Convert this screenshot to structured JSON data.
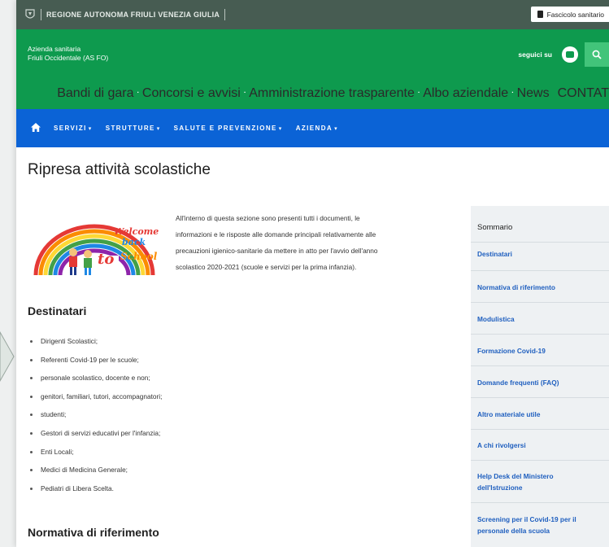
{
  "region_bar": {
    "text": "REGIONE AUTONOMA FRIULI VENEZIA GIULIA",
    "fascicolo_label": "Fascicolo sanitario"
  },
  "header": {
    "org_line1": "Azienda sanitaria",
    "org_line2": "Friuli Occidentale (AS FO)",
    "seguici": "seguici su",
    "service_links": [
      "Bandi di gara",
      "Concorsi e avvisi",
      "Amministrazione trasparente",
      "Albo aziendale",
      "News",
      "CONTAT"
    ]
  },
  "nav": {
    "items": [
      "SERVIZI",
      "STRUTTURE",
      "SALUTE E PREVENZIONE",
      "AZIENDA"
    ]
  },
  "main": {
    "title": "Ripresa attività scolastiche",
    "intro_lines": [
      "All'interno di questa sezione sono presenti tutti i documenti, le",
      "informazioni e le risposte alle domande principali relativamente alle",
      "precauzioni igienico-sanitarie da mettere in atto per l'avvio dell'anno",
      "scolastico 2020-2021 (scuole e servizi per la prima infanzia)."
    ],
    "logo_text": [
      "Welcome",
      "back",
      "to",
      "School"
    ],
    "destinatari_title": "Destinatari",
    "destinatari": [
      "Dirigenti Scolastici;",
      "Referenti Covid-19 per le scuole;",
      "personale scolastico, docente e non;",
      "genitori, familiari, tutori, accompagnatori;",
      "studenti;",
      "Gestori di servizi educativi per l'infanzia;",
      "Enti Locali;",
      "Medici di Medicina Generale;",
      "Pediatri di Libera Scelta."
    ],
    "normativa_title": "Normativa di riferimento"
  },
  "sommario": {
    "title": "Sommario",
    "links": [
      [
        "Destinatari"
      ],
      [
        "Normativa di riferimento"
      ],
      [
        "Modulistica"
      ],
      [
        "Formazione Covid-19"
      ],
      [
        "Domande frequenti (FAQ)"
      ],
      [
        "Altro materiale utile"
      ],
      [
        "A chi rivolgersi"
      ],
      [
        "Help Desk del Ministero",
        "dell'Istruzione"
      ],
      [
        "Screening per il Covid-19 per il",
        "personale della scuola"
      ]
    ]
  },
  "colors": {
    "region_bar": "#475c52",
    "header_green": "#0e9a4e",
    "nav_blue": "#0b63d6",
    "link_blue": "#1f5fbf",
    "sommario_bg": "#eef1f3"
  },
  "icons": {
    "region": "region-emblem-icon",
    "fascicolo": "document-icon",
    "youtube": "youtube-icon",
    "search": "search-icon",
    "home": "home-icon",
    "nav_caret": "caret-down-icon"
  }
}
